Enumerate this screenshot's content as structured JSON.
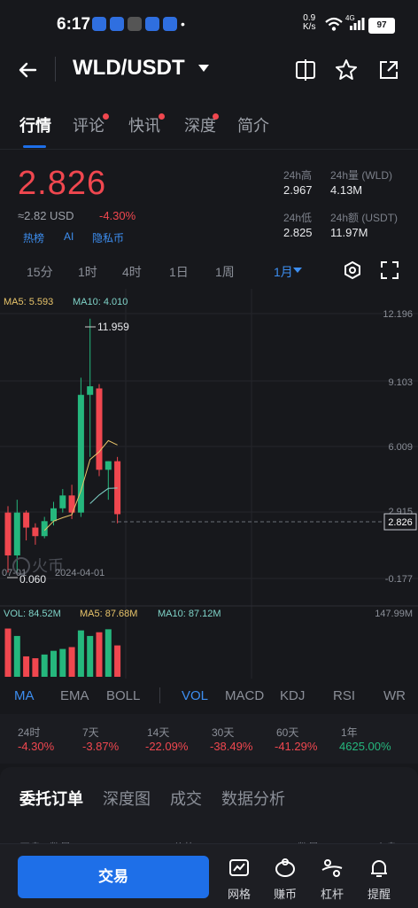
{
  "status": {
    "time": "6:17",
    "net_speed": "0.9",
    "net_unit": "K/s",
    "net_type": "4G",
    "battery": "97"
  },
  "header": {
    "pair": "WLD/USDT"
  },
  "tabs": [
    {
      "label": "行情",
      "active": true,
      "dot": false
    },
    {
      "label": "评论",
      "active": false,
      "dot": true
    },
    {
      "label": "快讯",
      "active": false,
      "dot": true
    },
    {
      "label": "深度",
      "active": false,
      "dot": true
    },
    {
      "label": "简介",
      "active": false,
      "dot": false
    }
  ],
  "ticker": {
    "price": "2.826",
    "approx": "≈2.82 USD",
    "change": "-4.30%",
    "tags": [
      "热榜",
      "AI",
      "隐私币"
    ],
    "high_label": "24h高",
    "high": "2.967",
    "vol_label": "24h量 (WLD)",
    "vol": "4.13M",
    "low_label": "24h低",
    "low": "2.825",
    "amount_label": "24h额 (USDT)",
    "amount": "11.97M"
  },
  "timeframes": [
    "15分",
    "1时",
    "4时",
    "1日",
    "1周",
    "1月"
  ],
  "active_timeframe": "1月",
  "chart_data": {
    "type": "candlestick",
    "ma_labels": {
      "ma5": "MA5: 5.593",
      "ma10": "MA10: 4.010"
    },
    "y_ticks": [
      "12.196",
      "9.103",
      "6.009",
      "2.915",
      "-0.177"
    ],
    "current_price_label": "2.826",
    "high_marker": "11.959",
    "low_marker": "0.060",
    "x_ticks": [
      "07-01",
      "2024-04-01"
    ],
    "watermark": "火币",
    "candles": [
      {
        "o": 2.9,
        "h": 3.2,
        "l": 0.1,
        "c": 0.9
      },
      {
        "o": 0.9,
        "h": 3.5,
        "l": 0.06,
        "c": 2.9
      },
      {
        "o": 2.9,
        "h": 3.0,
        "l": 1.6,
        "c": 2.2
      },
      {
        "o": 2.2,
        "h": 2.4,
        "l": 1.4,
        "c": 1.8
      },
      {
        "o": 1.8,
        "h": 2.7,
        "l": 1.7,
        "c": 2.5
      },
      {
        "o": 2.5,
        "h": 3.4,
        "l": 2.3,
        "c": 3.1
      },
      {
        "o": 3.1,
        "h": 4.0,
        "l": 2.9,
        "c": 3.7
      },
      {
        "o": 3.7,
        "h": 4.2,
        "l": 2.6,
        "c": 2.9
      },
      {
        "o": 2.9,
        "h": 9.2,
        "l": 2.7,
        "c": 8.4
      },
      {
        "o": 8.4,
        "h": 11.959,
        "l": 5.5,
        "c": 8.8
      },
      {
        "o": 8.7,
        "h": 8.9,
        "l": 4.6,
        "c": 4.9
      },
      {
        "o": 4.9,
        "h": 5.3,
        "l": 3.5,
        "c": 5.3
      },
      {
        "o": 5.3,
        "h": 5.5,
        "l": 2.4,
        "c": 2.826
      }
    ],
    "ma5": [
      null,
      null,
      null,
      null,
      2.06,
      2.5,
      2.66,
      2.8,
      3.92,
      5.38,
      5.74,
      6.26,
      6.06
    ],
    "ma10": [
      null,
      null,
      null,
      null,
      null,
      null,
      null,
      null,
      null,
      3.32,
      3.72,
      4.03,
      4.05
    ],
    "volume": {
      "labels": {
        "vol": "VOL: 84.52M",
        "ma5": "MA5: 87.68M",
        "ma10": "MA10: 87.12M",
        "max": "147.99M"
      },
      "bars": [
        130,
        110,
        55,
        50,
        60,
        70,
        75,
        80,
        125,
        110,
        120,
        128,
        84.52
      ],
      "max": 147.99
    }
  },
  "indicators": [
    "MA",
    "EMA",
    "BOLL",
    "VOL",
    "MACD",
    "KDJ",
    "RSI",
    "WR"
  ],
  "performance": [
    {
      "label": "24时",
      "value": "-4.30%",
      "up": false
    },
    {
      "label": "7天",
      "value": "-3.87%",
      "up": false
    },
    {
      "label": "14天",
      "value": "-22.09%",
      "up": false
    },
    {
      "label": "30天",
      "value": "-38.49%",
      "up": false
    },
    {
      "label": "60天",
      "value": "-41.29%",
      "up": false
    },
    {
      "label": "1年",
      "value": "4625.00%",
      "up": true
    }
  ],
  "order_tabs": [
    "委托订单",
    "深度图",
    "成交",
    "数据分析"
  ],
  "order_header": {
    "col1": "买盘",
    "col2": "数量 (WLD)",
    "col3": "价格 (USDT)",
    "col4": "数量 (WLD)",
    "col5": "卖盘"
  },
  "bottom": {
    "trade": "交易",
    "nav": [
      "网格",
      "赚币",
      "杠杆",
      "提醒"
    ]
  },
  "colors": {
    "up": "#25b77d",
    "down": "#f0474f",
    "accent": "#1e6fe8",
    "ma5": "#e8c46a",
    "ma10": "#7fd3c8"
  }
}
